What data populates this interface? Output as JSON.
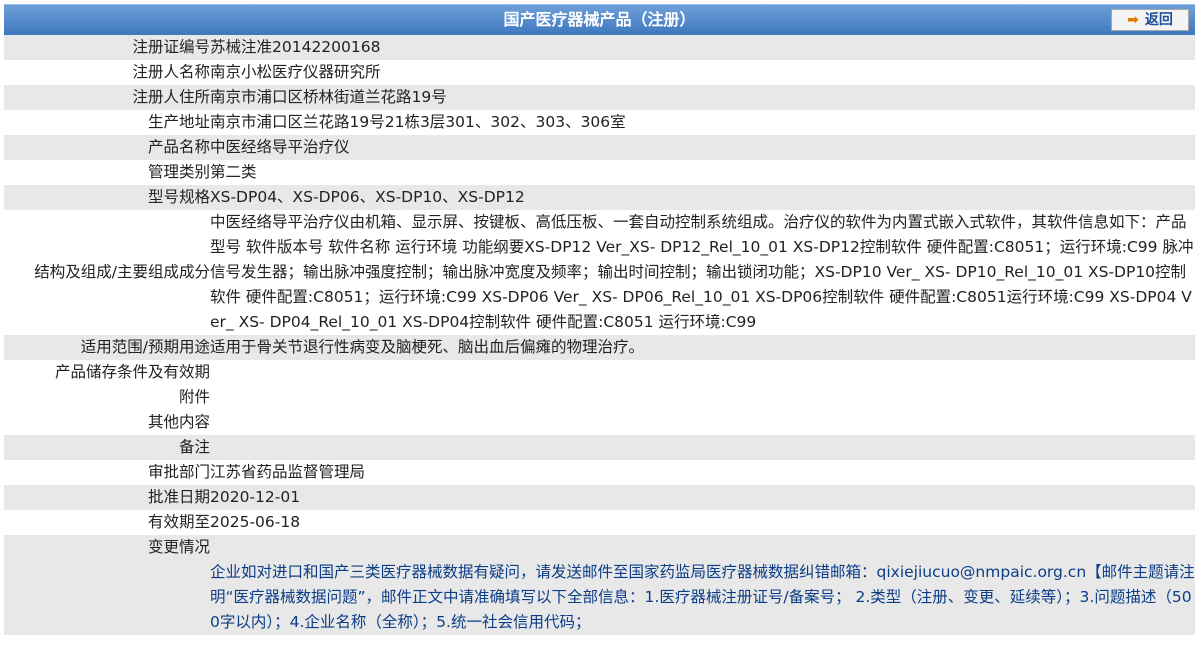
{
  "header": {
    "title": "国产医疗器械产品（注册）",
    "back_label": "返回"
  },
  "fields": [
    {
      "label": "注册证编号",
      "value": "苏械注准20142200168"
    },
    {
      "label": "注册人名称",
      "value": "南京小松医疗仪器研究所"
    },
    {
      "label": "注册人住所",
      "value": "南京市浦口区桥林街道兰花路19号"
    },
    {
      "label": "生产地址",
      "value": "南京市浦口区兰花路19号21栋3层301、302、303、306室"
    },
    {
      "label": "产品名称",
      "value": "中医经络导平治疗仪"
    },
    {
      "label": "管理类别",
      "value": "第二类"
    },
    {
      "label": "型号规格",
      "value": "XS-DP04、XS-DP06、XS-DP10、XS-DP12"
    },
    {
      "label": "结构及组成/主要组成成分",
      "value": "中医经络导平治疗仪由机箱、显示屏、按键板、高低压板、一套自动控制系统组成。治疗仪的软件为内置式嵌入式软件，其软件信息如下：产品型号 软件版本号 软件名称 运行环境 功能纲要XS-DP12 Ver_XS- DP12_Rel_10_01 XS-DP12控制软件 硬件配置:C8051；运行环境:C99 脉冲信号发生器；输出脉冲强度控制；输出脉冲宽度及频率；输出时间控制；输出锁闭功能；XS-DP10 Ver_ XS- DP10_Rel_10_01 XS-DP10控制软件 硬件配置:C8051；运行环境:C99 XS-DP06 Ver_ XS- DP06_Rel_10_01 XS-DP06控制软件 硬件配置:C8051运行环境:C99 XS-DP04 Ver_ XS- DP04_Rel_10_01 XS-DP04控制软件 硬件配置:C8051 运行环境:C99"
    },
    {
      "label": "适用范围/预期用途",
      "value": "适用于骨关节退行性病变及脑梗死、脑出血后偏瘫的物理治疗。"
    },
    {
      "label": "产品储存条件及有效期",
      "value": ""
    },
    {
      "label": "附件",
      "value": ""
    },
    {
      "label": "其他内容",
      "value": ""
    },
    {
      "label": "备注",
      "value": ""
    },
    {
      "label": "审批部门",
      "value": "江苏省药品监督管理局"
    },
    {
      "label": "批准日期",
      "value": "2020-12-01"
    },
    {
      "label": "有效期至",
      "value": "2025-06-18"
    },
    {
      "label": "变更情况",
      "value": ""
    }
  ],
  "notice": "企业如对进口和国产三类医疗器械数据有疑问，请发送邮件至国家药监局医疗器械数据纠错邮箱：qixiejiucuo@nmpaic.org.cn【邮件主题请注明“医疗器械数据问题”，邮件正文中请准确填写以下全部信息：1.医疗器械注册证号/备案号； 2.类型（注册、变更、延续等）；3.问题描述（500字以内）；4.企业名称（全称）；5.统一社会信用代码；"
}
